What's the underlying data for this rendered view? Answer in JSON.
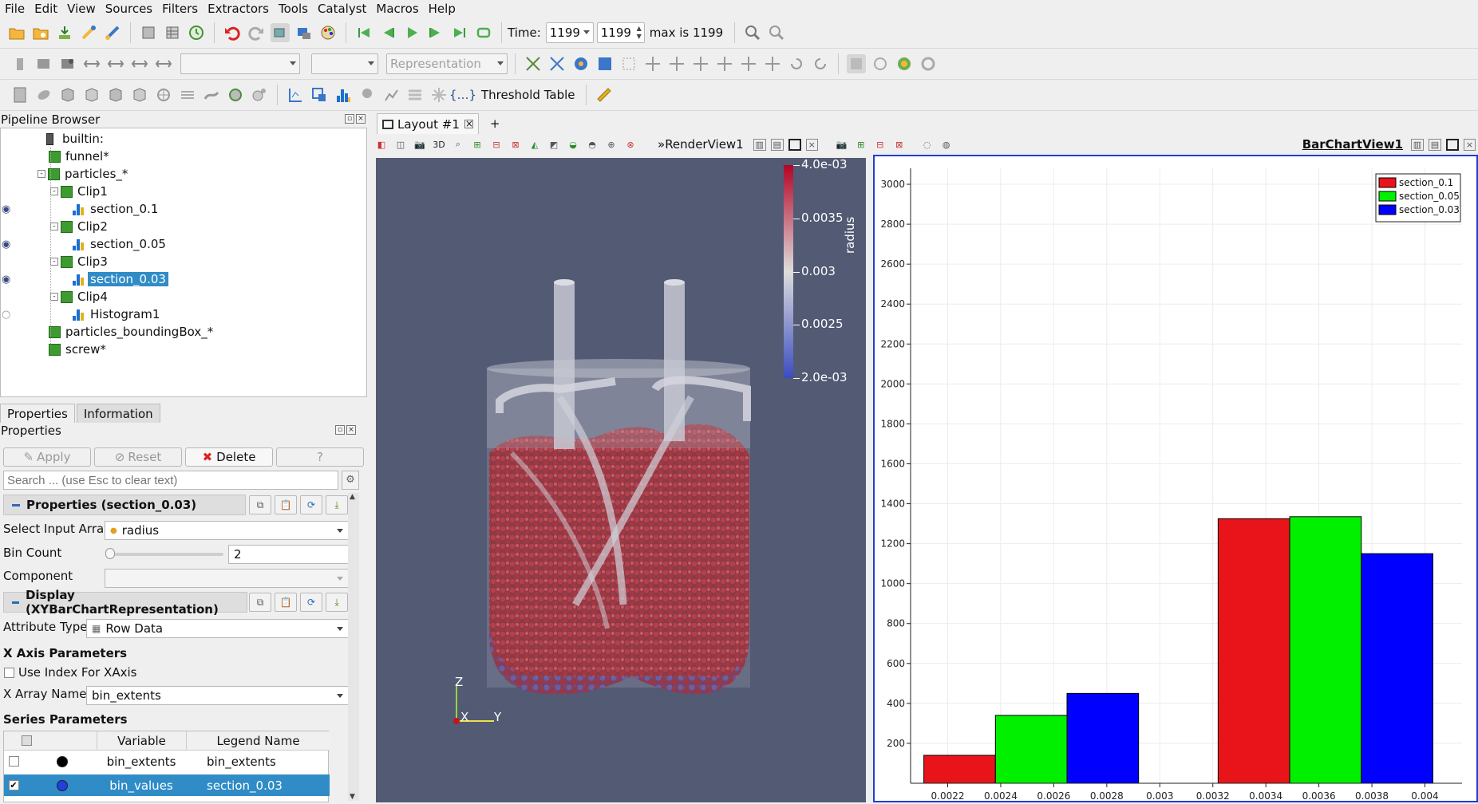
{
  "menu": [
    "File",
    "Edit",
    "View",
    "Sources",
    "Filters",
    "Extractors",
    "Tools",
    "Catalyst",
    "Macros",
    "Help"
  ],
  "toolbar1": {
    "time_label": "Time:",
    "time_value": "1199",
    "time_index": "1199",
    "max_label": "max is 1199"
  },
  "toolbar2": {
    "representation_placeholder": "Representation"
  },
  "toolbar3": {
    "threshold_table_label": "Threshold Table"
  },
  "pipeline": {
    "title": "Pipeline Browser",
    "items": [
      {
        "label": "builtin:",
        "indent": 0,
        "kind": "server",
        "eye": "none"
      },
      {
        "label": "funnel*",
        "indent": 1,
        "kind": "cube",
        "eye": "none"
      },
      {
        "label": "particles_*",
        "indent": 1,
        "kind": "cube",
        "eye": "none",
        "expand": "-"
      },
      {
        "label": "Clip1",
        "indent": 2,
        "kind": "cube",
        "eye": "none",
        "expand": "-"
      },
      {
        "label": "section_0.1",
        "indent": 3,
        "kind": "hist",
        "eye": "open"
      },
      {
        "label": "Clip2",
        "indent": 2,
        "kind": "cube",
        "eye": "none",
        "expand": "-"
      },
      {
        "label": "section_0.05",
        "indent": 3,
        "kind": "hist",
        "eye": "open"
      },
      {
        "label": "Clip3",
        "indent": 2,
        "kind": "cube",
        "eye": "none",
        "expand": "-"
      },
      {
        "label": "section_0.03",
        "indent": 3,
        "kind": "hist",
        "eye": "open",
        "selected": true
      },
      {
        "label": "Clip4",
        "indent": 2,
        "kind": "cube",
        "eye": "none",
        "expand": "-"
      },
      {
        "label": "Histogram1",
        "indent": 3,
        "kind": "hist",
        "eye": "closed"
      },
      {
        "label": "particles_boundingBox_*",
        "indent": 1,
        "kind": "cube",
        "eye": "none"
      },
      {
        "label": "screw*",
        "indent": 1,
        "kind": "cube",
        "eye": "none"
      }
    ]
  },
  "tabs": {
    "properties": "Properties",
    "information": "Information"
  },
  "properties": {
    "title": "Properties",
    "apply": "Apply",
    "reset": "Reset",
    "delete": "Delete",
    "help": "?",
    "search_placeholder": "Search ... (use Esc to clear text)",
    "section1": "Properties (section_0.03)",
    "select_input_label": "Select Input Array",
    "select_input_value": "radius",
    "bin_count_label": "Bin Count",
    "bin_count_value": "2",
    "component_label": "Component",
    "section2": "Display (XYBarChartRepresentation)",
    "attribute_type_label": "Attribute Type",
    "attribute_type_value": "Row Data",
    "x_axis_header": "X Axis Parameters",
    "use_index_label": "Use Index For XAxis",
    "x_array_label": "X Array Name",
    "x_array_value": "bin_extents",
    "series_header": "Series Parameters",
    "series_columns": [
      "Variable",
      "Legend Name"
    ],
    "series_rows": [
      {
        "checked": false,
        "color": "#000000",
        "variable": "bin_extents",
        "legend": "bin_extents"
      },
      {
        "checked": true,
        "color": "#1f3fe0",
        "variable": "bin_values",
        "legend": "section_0.03",
        "selected": true
      }
    ]
  },
  "layout": {
    "tab_label": "Layout #1",
    "add_tab": "+",
    "render_view_label": "RenderView1",
    "chart_view_label": "BarChartView1",
    "threed_label": "3D"
  },
  "colorbar": {
    "title": "radius",
    "ticks": [
      "4.0e-03",
      "0.0035",
      "0.003",
      "0.0025",
      "2.0e-03"
    ],
    "colors": {
      "high": "#b40426",
      "mid": "#dddddd",
      "low": "#3b4cc0"
    }
  },
  "axes_triad": {
    "z": "Z",
    "x": "X",
    "y": "Y"
  },
  "chart_data": {
    "type": "bar",
    "x_ticks": [
      "0.0022",
      "0.0024",
      "0.0026",
      "0.0028",
      "0.003",
      "0.0032",
      "0.0034",
      "0.0036",
      "0.0038",
      "0.004"
    ],
    "y_ticks": [
      "200",
      "400",
      "600",
      "800",
      "1000",
      "1200",
      "1400",
      "1600",
      "1800",
      "2000",
      "2200",
      "2400",
      "2600",
      "2800",
      "3000"
    ],
    "xlim": [
      0.00206,
      0.00414
    ],
    "ylim": [
      0,
      3080
    ],
    "series": [
      {
        "name": "section_0.1",
        "color": "#e8141a",
        "bins": [
          [
            0.00211,
            0.00238,
            140
          ],
          [
            0.00322,
            0.00349,
            1325
          ]
        ]
      },
      {
        "name": "section_0.05",
        "color": "#00f000",
        "bins": [
          [
            0.00238,
            0.00265,
            340
          ],
          [
            0.00349,
            0.00376,
            1335
          ]
        ]
      },
      {
        "name": "section_0.03",
        "color": "#0000ff",
        "bins": [
          [
            0.00265,
            0.00292,
            450
          ],
          [
            0.00376,
            0.00403,
            1150
          ]
        ]
      }
    ],
    "legend_position": "top-right",
    "grid": true
  }
}
